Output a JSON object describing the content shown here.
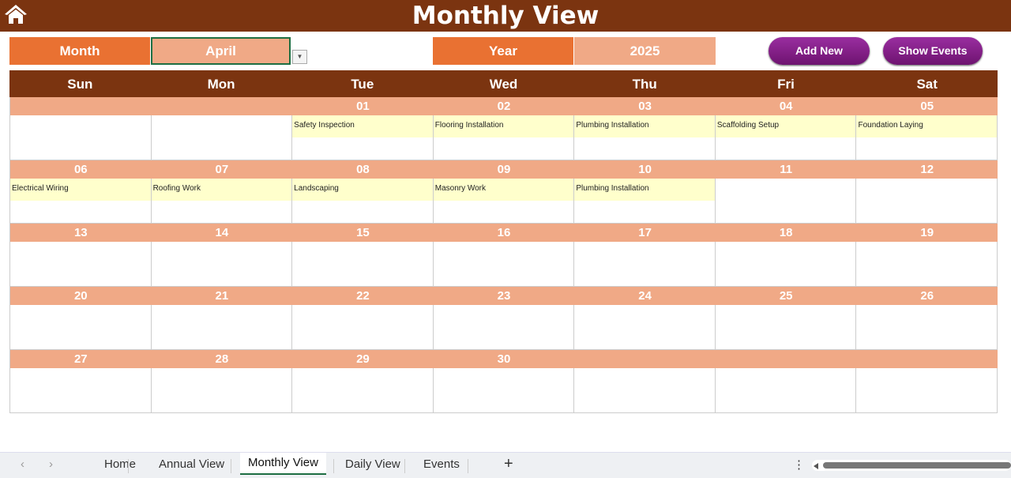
{
  "title": "Monthly View",
  "month_label": "Month",
  "month_value": "April",
  "year_label": "Year",
  "year_value": "2025",
  "buttons": {
    "add_new": "Add New",
    "show_events": "Show Events"
  },
  "colors": {
    "header": "#7b3410",
    "label": "#e97132",
    "value": "#f0a986",
    "event": "#ffffcc",
    "button": "#8a2190"
  },
  "weekdays": [
    "Sun",
    "Mon",
    "Tue",
    "Wed",
    "Thu",
    "Fri",
    "Sat"
  ],
  "weeks": [
    [
      {
        "date": "",
        "event": ""
      },
      {
        "date": "",
        "event": ""
      },
      {
        "date": "01",
        "event": "Safety Inspection"
      },
      {
        "date": "02",
        "event": "Flooring Installation"
      },
      {
        "date": "03",
        "event": "Plumbing Installation"
      },
      {
        "date": "04",
        "event": "Scaffolding Setup"
      },
      {
        "date": "05",
        "event": "Foundation Laying"
      }
    ],
    [
      {
        "date": "06",
        "event": "Electrical Wiring"
      },
      {
        "date": "07",
        "event": "Roofing Work"
      },
      {
        "date": "08",
        "event": "Landscaping"
      },
      {
        "date": "09",
        "event": "Masonry Work"
      },
      {
        "date": "10",
        "event": "Plumbing Installation"
      },
      {
        "date": "11",
        "event": ""
      },
      {
        "date": "12",
        "event": ""
      }
    ],
    [
      {
        "date": "13",
        "event": ""
      },
      {
        "date": "14",
        "event": ""
      },
      {
        "date": "15",
        "event": ""
      },
      {
        "date": "16",
        "event": ""
      },
      {
        "date": "17",
        "event": ""
      },
      {
        "date": "18",
        "event": ""
      },
      {
        "date": "19",
        "event": ""
      }
    ],
    [
      {
        "date": "20",
        "event": ""
      },
      {
        "date": "21",
        "event": ""
      },
      {
        "date": "22",
        "event": ""
      },
      {
        "date": "23",
        "event": ""
      },
      {
        "date": "24",
        "event": ""
      },
      {
        "date": "25",
        "event": ""
      },
      {
        "date": "26",
        "event": ""
      }
    ],
    [
      {
        "date": "27",
        "event": ""
      },
      {
        "date": "28",
        "event": ""
      },
      {
        "date": "29",
        "event": ""
      },
      {
        "date": "30",
        "event": ""
      },
      {
        "date": "",
        "event": ""
      },
      {
        "date": "",
        "event": ""
      },
      {
        "date": "",
        "event": ""
      }
    ]
  ],
  "sheet_tabs": [
    "Home",
    "Annual View",
    "Monthly View",
    "Daily View",
    "Events"
  ],
  "active_tab": "Monthly View"
}
